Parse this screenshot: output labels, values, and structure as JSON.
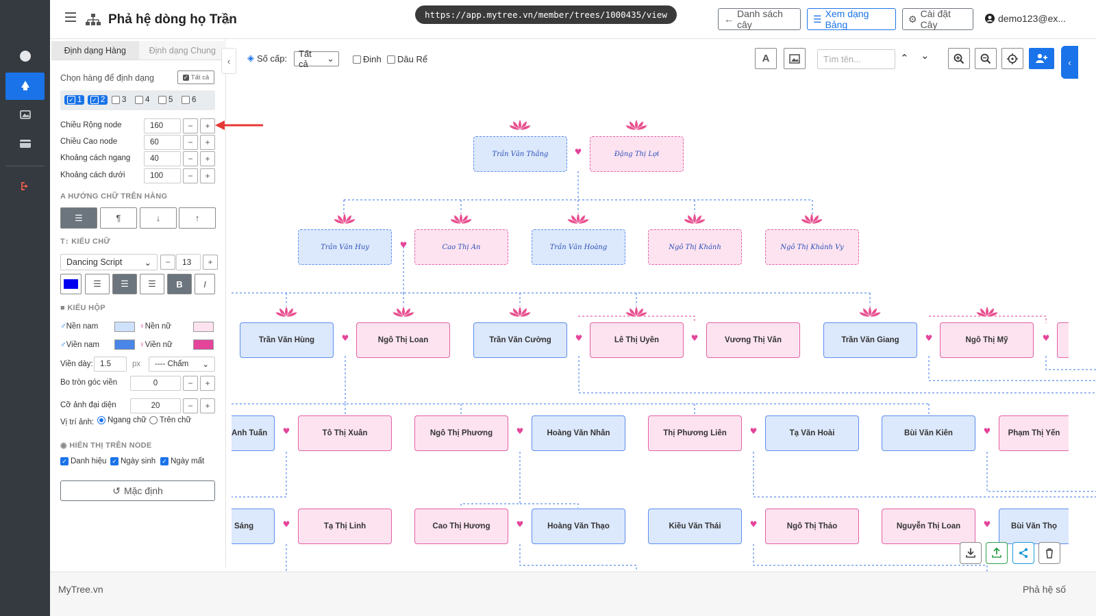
{
  "app": {
    "title": "Phả hệ dòng họ Trần",
    "url": "https://app.mytree.vn/member/trees/1000435/view",
    "nav": {
      "list": "Danh sách cây",
      "table": "Xem dạng Bảng",
      "settings": "Cài đặt Cây",
      "user": "demo123@ex..."
    }
  },
  "panel": {
    "tabs": [
      "Định dạng Hàng",
      "Định dạng Chung"
    ],
    "row_select_label": "Chọn hàng để định dạng",
    "all_label": "Tất cả",
    "rows": [
      {
        "label": "1",
        "checked": true
      },
      {
        "label": "2",
        "checked": true
      },
      {
        "label": "3",
        "checked": false
      },
      {
        "label": "4",
        "checked": false
      },
      {
        "label": "5",
        "checked": false
      },
      {
        "label": "6",
        "checked": false
      }
    ],
    "dims": [
      {
        "label": "Chiều Rộng node",
        "value": "160"
      },
      {
        "label": "Chiều Cao node",
        "value": "60"
      },
      {
        "label": "Khoảng cách ngang",
        "value": "40"
      },
      {
        "label": "Khoảng cách dưới",
        "value": "100"
      }
    ],
    "text_dir_title": "HƯỚNG CHỮ TRÊN HÀNG",
    "font_title": "KIỂU CHỮ",
    "font_name": "Dancing Script",
    "font_size": "13",
    "box_title": "KIỂU HỘP",
    "male_bg": "Nền nam",
    "female_bg": "Nền nữ",
    "male_border": "Viền nam",
    "female_border": "Viền nữ",
    "border_width_label": "Viền dày:",
    "border_width": "1.5",
    "border_unit": "px",
    "border_style": "---- Chấm",
    "radius_label": "Bo tròn góc viền",
    "radius": "0",
    "avatar_label": "Cỡ ảnh đại diện",
    "avatar_size": "20",
    "avatar_pos_label": "Vị trí ảnh:",
    "avatar_pos_options": [
      "Ngang chữ",
      "Trên chữ"
    ],
    "display_title": "HIỂN THỊ TRÊN NODE",
    "display_opts": [
      "Danh hiệu",
      "Ngày sinh",
      "Ngày mất"
    ],
    "reset_label": "Mặc định",
    "colors": {
      "male_bg": "#cfe0fa",
      "female_bg": "#fde3ef",
      "male_border": "#4a86e8",
      "female_border": "#e4449a",
      "font_color": "#0000ee"
    }
  },
  "toolbar": {
    "levels_label": "Số cấp:",
    "levels_value": "Tất cả",
    "pin_label": "Đinh",
    "inlaw_label": "Dâu Rể",
    "search_placeholder": "Tìm tên..."
  },
  "tree": {
    "gen1": [
      "Trần Văn Thắng",
      "Đặng Thị Lợi"
    ],
    "gen2": [
      "Trần Văn Huy",
      "Cao Thị An",
      "Trần Văn Hoàng",
      "Ngô Thị Khánh",
      "Ngô Thị Khánh Vy"
    ],
    "gen3": [
      "Trần Văn Hùng",
      "Ngô Thị Loan",
      "Trần Văn Cường",
      "Lê Thị Uyên",
      "Vương Thị Vân",
      "Trần Văn Giang",
      "Ngô Thị Mỹ"
    ],
    "gen4": [
      "Anh Tuấn",
      "Tô Thị Xuân",
      "Ngô Thị Phương",
      "Hoàng Văn Nhân",
      "Thị Phương Liên",
      "Tạ Văn Hoài",
      "Bùi Văn Kiên",
      "Phạm Thị Yến"
    ],
    "gen5": [
      "Sáng",
      "Tạ Thị Linh",
      "Cao Thị Hương",
      "Hoàng Văn Thạo",
      "Kiều Văn Thái",
      "Ngô Thị Thảo",
      "Nguyễn Thị Loan",
      "Bùi Văn Thọ"
    ]
  },
  "footer": {
    "left": "MyTree.vn",
    "right": "Phả hệ số"
  }
}
